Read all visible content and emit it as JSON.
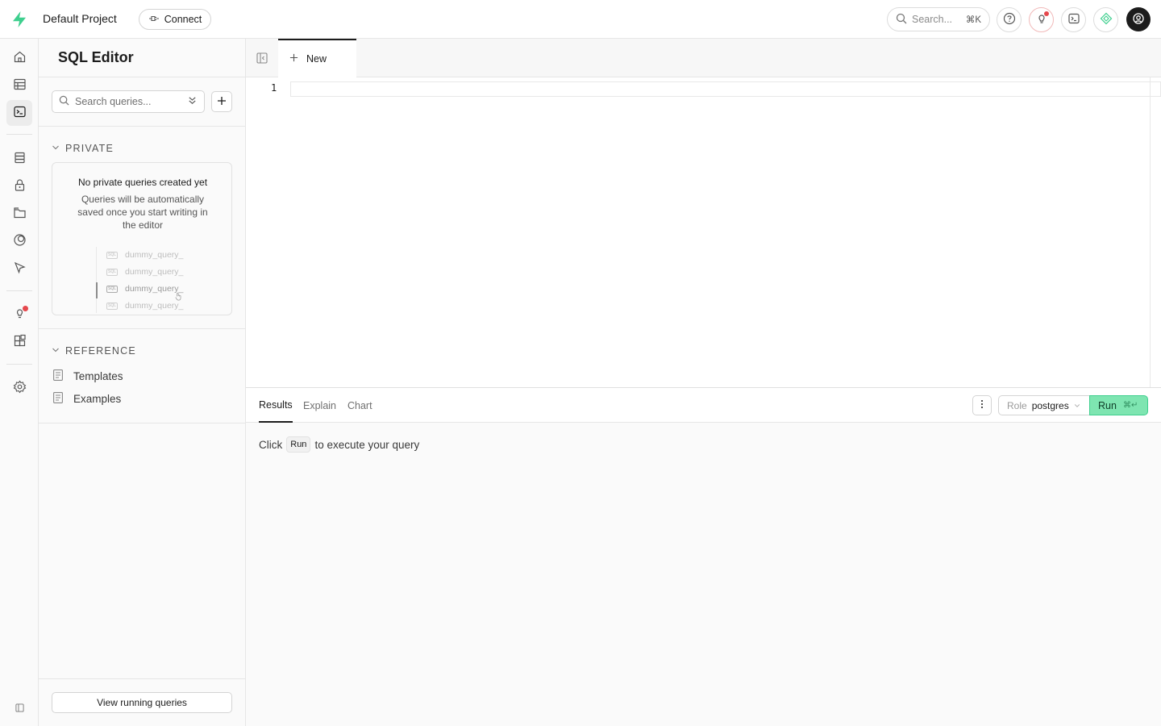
{
  "header": {
    "project_name": "Default Project",
    "connect_label": "Connect",
    "search_placeholder": "Search...",
    "search_shortcut": "⌘K",
    "brand_color": "#3ecf8e"
  },
  "leftnav": {
    "items": [
      "home-icon",
      "table-editor-icon",
      "sql-editor-icon",
      "database-icon",
      "auth-lock-icon",
      "storage-icon",
      "realtime-icon",
      "edge-functions-icon",
      "advisors-icon",
      "integrations-icon",
      "settings-icon",
      "collapse-sidebar-icon"
    ]
  },
  "sidebar": {
    "title": "SQL Editor",
    "search_placeholder": "Search queries...",
    "private_label": "PRIVATE",
    "empty_title": "No private queries created yet",
    "empty_desc": "Queries will be automatically saved once you start writing in the editor",
    "dummy_items": [
      "dummy_query_",
      "dummy_query_",
      "dummy_query_",
      "dummy_query_"
    ],
    "reference_label": "REFERENCE",
    "reference_items": [
      "Templates",
      "Examples"
    ],
    "view_running_label": "View running queries"
  },
  "editor": {
    "tab_label": "New",
    "line_numbers": [
      "1"
    ]
  },
  "results": {
    "tabs": [
      "Results",
      "Explain",
      "Chart"
    ],
    "role_label": "Role",
    "role_value": "postgres",
    "run_label": "Run",
    "run_shortcut": "⌘↵",
    "hint_prefix": "Click",
    "hint_chip": "Run",
    "hint_suffix": "to execute your query",
    "run_color": "#7ee5b1"
  }
}
